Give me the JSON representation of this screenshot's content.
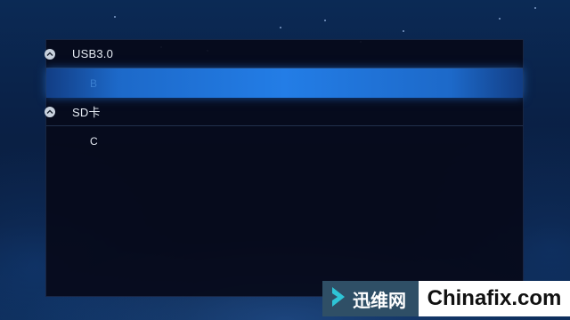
{
  "groups": [
    {
      "label": "USB3.0",
      "items": [
        {
          "label": "B",
          "selected": true
        }
      ]
    },
    {
      "label": "SD卡",
      "items": [
        {
          "label": "C",
          "selected": false
        }
      ]
    }
  ],
  "watermark": {
    "chinese_name": "迅维网",
    "english_name": "Chinafix.com"
  },
  "colors": {
    "background": "#0a2147",
    "panel": "#060a1a",
    "selection": "#237de6",
    "text": "#e6ecf4",
    "watermark_left": "#2f4f66",
    "watermark_arrow": "#2ec4d6"
  },
  "icons": {
    "group_toggle": "collapse-up-icon",
    "watermark_logo": "chevron-right-icon"
  }
}
